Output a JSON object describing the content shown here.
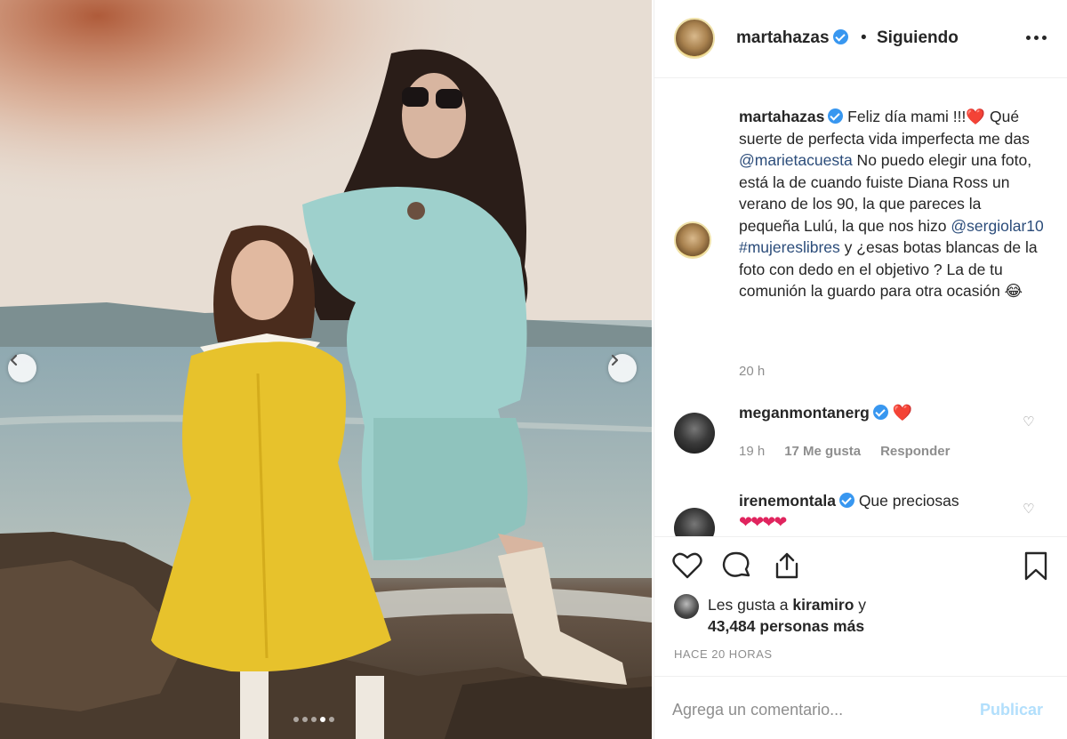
{
  "post": {
    "image_alt": "Madre e hija en la playa",
    "carousel_dots": 5,
    "active_dot": 4
  },
  "header": {
    "username": "martahazas",
    "separator": "•",
    "follow_status": "Siguiendo",
    "more_icon": "more-horizontal-icon"
  },
  "caption": {
    "username": "martahazas",
    "text_before_mention1": " Feliz día mami !!!❤️ Qué suerte de perfecta vida imperfecta me das ",
    "mention1": "@marietacuesta",
    "text_before_mention2": " No puedo elegir una foto, está la de cuando fuiste Diana Ross un verano de los 90, la que pareces la pequeña Lulú, la que nos hizo ",
    "mention2": "@sergiolar10",
    "hashtag": "#mujereslibres",
    "text_after_hashtag": " y ¿esas botas blancas de la foto con dedo en el objetivo ? La de tu comunión la guardo para otra ocasión 😂",
    "time": "20 h"
  },
  "comments": [
    {
      "username": "meganmontanerg",
      "text": "❤️",
      "time": "19 h",
      "likes": "17 Me gusta",
      "reply": "Responder"
    },
    {
      "username": "irenemontala",
      "text": "Que preciosas",
      "extra": "❤❤❤❤"
    }
  ],
  "likes": {
    "prefix": "Les gusta a ",
    "user": "kiramiro",
    "conj": " y",
    "count": "43,484 personas más"
  },
  "posted_time": "HACE 20 HORAS",
  "add_comment": {
    "placeholder": "Agrega un comentario...",
    "publish": "Publicar"
  },
  "colors": {
    "link": "#2b4c7a",
    "verified": "#3897f0",
    "heart": "#e0245e",
    "publish_disabled": "#b2dffc"
  }
}
